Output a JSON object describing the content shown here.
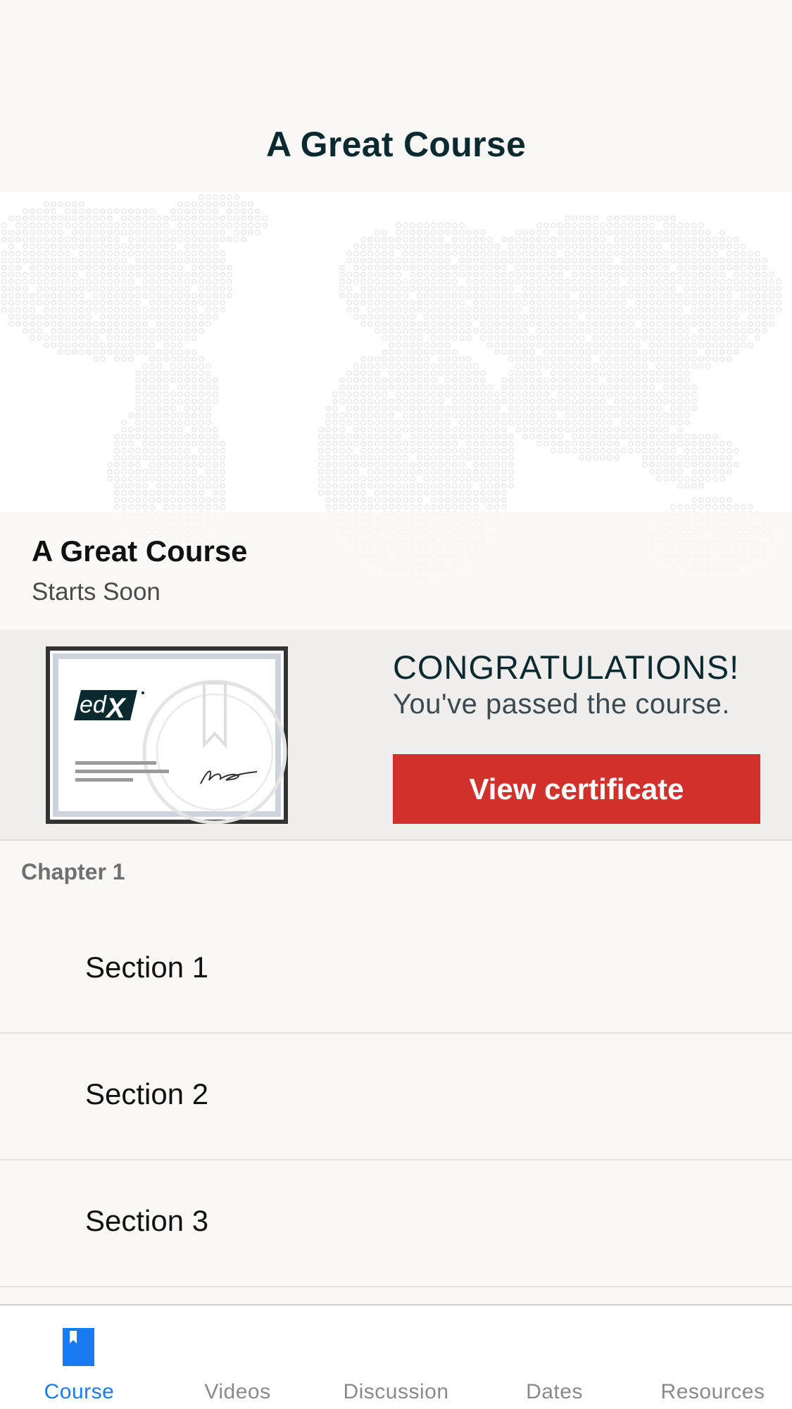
{
  "navbar": {
    "title": "A Great Course"
  },
  "course_header": {
    "name": "A Great Course",
    "status": "Starts Soon"
  },
  "certificate_banner": {
    "logo_text": "edX",
    "title": "CONGRATULATIONS!",
    "subtitle": "You've passed the course.",
    "button_label": "View certificate",
    "button_color": "#d2312b"
  },
  "outline": {
    "chapter_title": "Chapter 1",
    "sections": [
      {
        "label": "Section 1"
      },
      {
        "label": "Section 2"
      },
      {
        "label": "Section 3"
      }
    ]
  },
  "tabbar": {
    "active_color": "#1a7bf0",
    "tabs": [
      {
        "label": "Course",
        "icon": "bookmark-icon",
        "active": true
      },
      {
        "label": "Videos",
        "active": false
      },
      {
        "label": "Discussion",
        "active": false
      },
      {
        "label": "Dates",
        "active": false
      },
      {
        "label": "Resources",
        "active": false
      }
    ]
  }
}
